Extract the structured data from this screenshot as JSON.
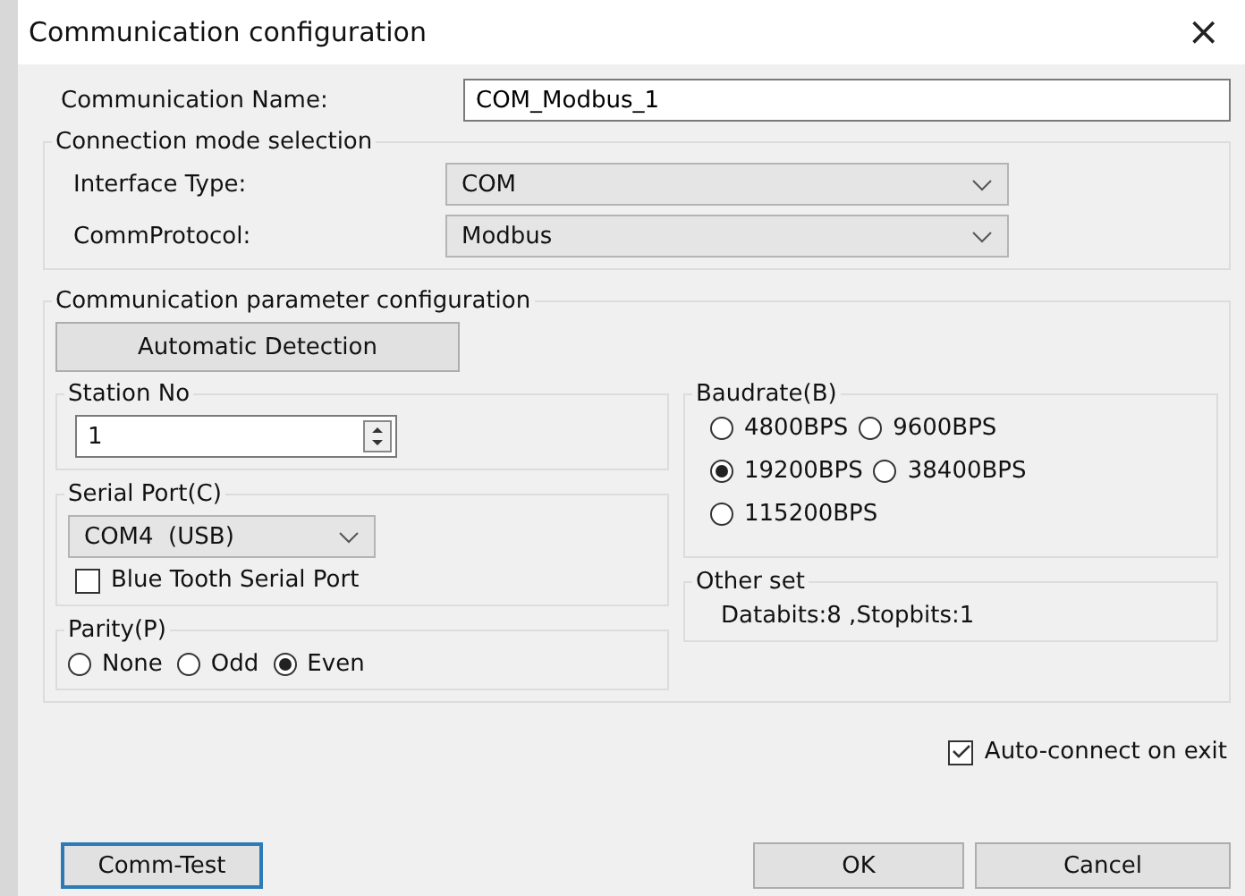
{
  "window": {
    "title": "Communication configuration",
    "close": "×"
  },
  "name_field": {
    "label": "Communication Name:",
    "value": "COM_Modbus_1"
  },
  "connection": {
    "title": "Connection mode selection",
    "rows": [
      {
        "label": "Interface Type:",
        "value": "COM"
      },
      {
        "label": "CommProtocol:",
        "value": "Modbus"
      }
    ]
  },
  "parameters": {
    "title": "Communication parameter configuration",
    "detect_button": "Automatic Detection",
    "station": {
      "title": "Station No",
      "value": "1"
    },
    "serial_port": {
      "title": "Serial Port(C)",
      "value": "COM4  (USB)",
      "bluetooth": {
        "label": "Blue Tooth Serial Port",
        "checked": false
      }
    },
    "parity": {
      "title": "Parity(P)",
      "options": [
        {
          "label": "None",
          "selected": false
        },
        {
          "label": "Odd",
          "selected": false
        },
        {
          "label": "Even",
          "selected": true
        }
      ]
    },
    "baudrate": {
      "title": "Baudrate(B)",
      "options": [
        {
          "label": "4800BPS",
          "selected": false
        },
        {
          "label": "9600BPS",
          "selected": false
        },
        {
          "label": "19200BPS",
          "selected": true
        },
        {
          "label": "38400BPS",
          "selected": false
        },
        {
          "label": "115200BPS",
          "selected": false
        }
      ]
    },
    "other": {
      "title": "Other set",
      "text": "Databits:8 ,Stopbits:1"
    }
  },
  "auto_connect": {
    "label": "Auto-connect on exit",
    "checked": true
  },
  "buttons": [
    {
      "label": "Comm-Test",
      "focused": true
    },
    {
      "label": "OK",
      "focused": false
    },
    {
      "label": "Cancel",
      "focused": false
    }
  ]
}
